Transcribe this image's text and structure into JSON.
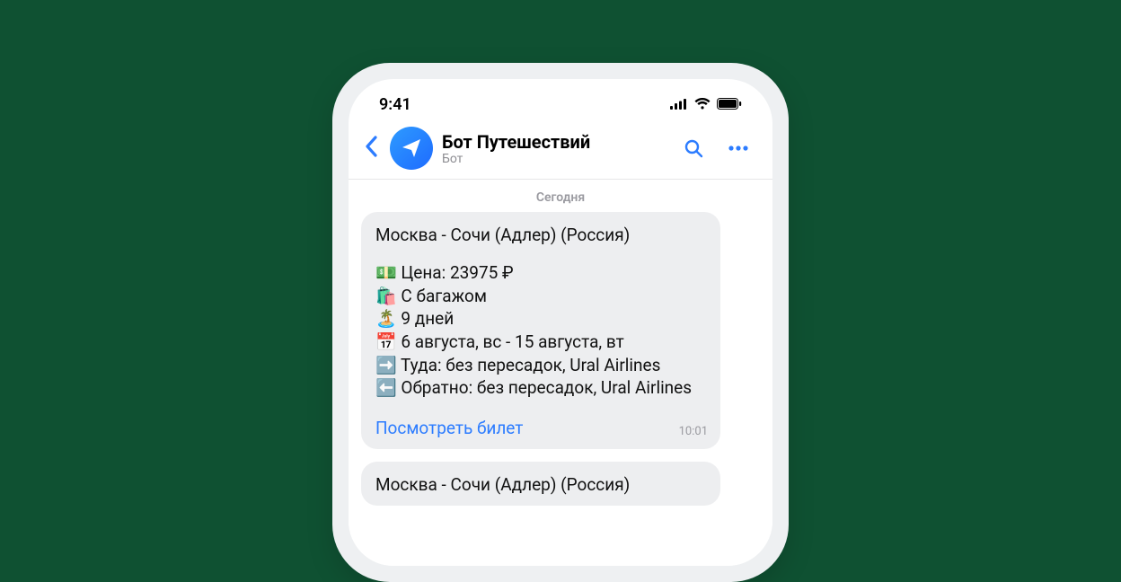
{
  "status": {
    "time": "9:41"
  },
  "header": {
    "title": "Бот Путешествий",
    "subtitle": "Бот"
  },
  "chat": {
    "date_separator": "Сегодня",
    "messages": [
      {
        "title": "Москва - Сочи (Адлер) (Россия)",
        "price_line": "💵 Цена: 23975 ₽",
        "baggage_line": "🛍️ С багажом",
        "duration_line": "🏝️ 9 дней",
        "dates_line": "📅 6 августа, вс - 15 августа, вт",
        "outbound_line": "➡️ Туда: без пересадок, Ural Airlines",
        "return_line": "⬅️ Обратно: без пересадок, Ural Airlines",
        "link_label": "Посмотреть билет",
        "time": "10:01"
      },
      {
        "title": "Москва - Сочи (Адлер) (Россия)"
      }
    ]
  }
}
